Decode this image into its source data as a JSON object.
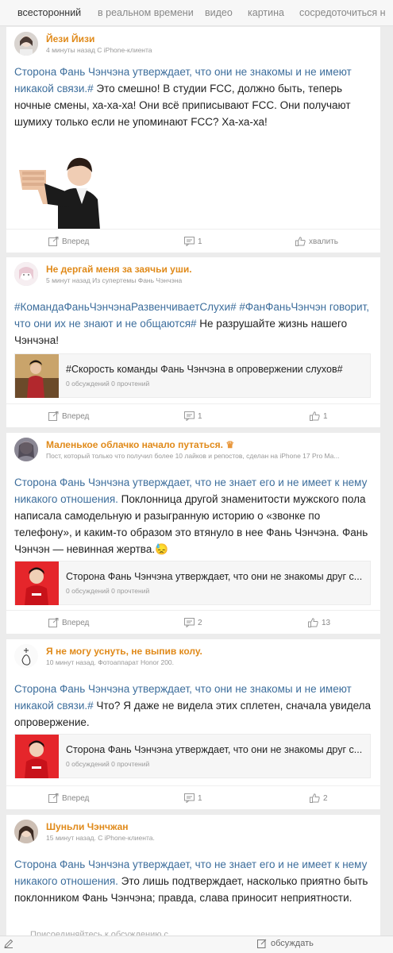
{
  "tabs": [
    "всесторонний",
    "в реальном времени",
    "видео",
    "картина",
    "сосредоточиться н"
  ],
  "posts": [
    {
      "user": "Йези Йизи",
      "meta": "4 минуты назад С iPhone-клиента",
      "tag": "Сторона Фань Чэнчэна утверждает, что они не знакомы и не имеют никакой связи.#",
      "text": " Это смешно! В студии FCC, должно быть, теперь ночные смены, ха-ха-ха! Они всё приписывают FCC. Они получают шумиху только если не упоминают FCC? Ха-ха-ха!",
      "actions": {
        "forward": "Вперед",
        "comments": "1",
        "like": "хвалить"
      }
    },
    {
      "user": "Не дергай меня за заячьи уши.",
      "meta": "5 минут назад Из супертемы Фань Чэнчэна",
      "tag": "#КомандаФаньЧэнчэнаРазвенчиваетСлухи# #ФанФаньЧэнчэн говорит, что они их не знают и не общаются#",
      "text": " Не разрушайте жизнь нашего Чэнчэна!",
      "link": {
        "title": "#Скорость команды Фань Чэнчэна в опровержении слухов#",
        "stats": "0 обсуждений 0 прочтений"
      },
      "actions": {
        "forward": "Вперед",
        "comments": "1",
        "like": "1"
      }
    },
    {
      "user": "Маленькое облачко начало путаться.",
      "meta": "Пост, который только что получил более 10 лайков и репостов, сделан на iPhone 17 Pro Ma...",
      "tag": "Сторона Фань Чэнчэна утверждает, что не знает его и не имеет к нему никакого отношения.",
      "text": " Поклонница другой знаменитости мужского пола написала самодельную и разыгранную историю о «звонке по телефону», и каким-то образом это втянуло в нее Фань Чэнчэна. Фань Чэнчэн — невинная жертва.",
      "emoji": "😓",
      "link": {
        "title": "Сторона Фань Чэнчэна утверждает, что они не знакомы друг с...",
        "stats": "0 обсуждений 0 прочтений"
      },
      "actions": {
        "forward": "Вперед",
        "comments": "2",
        "like": "13"
      }
    },
    {
      "user": "Я не могу уснуть, не выпив колу.",
      "meta": "10 минут назад. Фотоаппарат Honor 200.",
      "tag": "Сторона Фань Чэнчэна утверждает, что они не знакомы и не имеют никакой связи.#",
      "text": " Что? Я даже не видела этих сплетен, сначала увидела опровержение.",
      "link": {
        "title": "Сторона Фань Чэнчэна утверждает, что они не знакомы друг с...",
        "stats": "0 обсуждений 0 прочтений"
      },
      "actions": {
        "forward": "Вперед",
        "comments": "1",
        "like": "2"
      }
    },
    {
      "user": "Шуньли Чэнчжан",
      "meta": "15 минут назад. С iPhone-клиента.",
      "tag": "Сторона Фань Чэнчэна утверждает, что не знает его и не имеет к нему никакого отношения.",
      "text": " Это лишь подтверждает, насколько приятно быть поклонником Фань Чэнчэна; правда, слава приносит неприятности."
    }
  ],
  "bottom": {
    "input_placeholder": "Присоединяйтесь к обсуждению с",
    "discuss": "обсуждать"
  },
  "colors": {
    "username": "#e08a1a",
    "hashtag": "#3d6e9c",
    "meta": "#999999",
    "background": "#ececec"
  }
}
